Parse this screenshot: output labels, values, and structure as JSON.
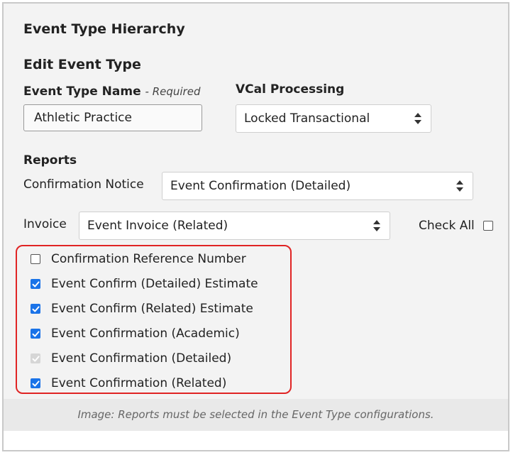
{
  "header": {
    "title": "Event Type Hierarchy",
    "subtitle": "Edit Event Type"
  },
  "form": {
    "name_label": "Event Type Name",
    "required_label": "- Required",
    "name_value": "Athletic Practice",
    "vcal_label": "VCal Processing",
    "vcal_value": "Locked Transactional"
  },
  "reports": {
    "section_label": "Reports",
    "confirmation_label": "Confirmation Notice",
    "confirmation_value": "Event Confirmation (Detailed)",
    "invoice_label": "Invoice",
    "invoice_value": "Event Invoice (Related)",
    "check_all_label": "Check All",
    "items": [
      {
        "label": "Confirmation Reference Number",
        "state": "unchecked"
      },
      {
        "label": "Event Confirm (Detailed) Estimate",
        "state": "checked"
      },
      {
        "label": "Event Confirm (Related) Estimate",
        "state": "checked"
      },
      {
        "label": "Event Confirmation (Academic)",
        "state": "checked"
      },
      {
        "label": "Event Confirmation (Detailed)",
        "state": "checked-disabled"
      },
      {
        "label": "Event Confirmation (Related)",
        "state": "checked"
      }
    ]
  },
  "caption": "Image: Reports must be selected in the Event Type configurations.",
  "colors": {
    "checkbox_accent": "#1a73e8",
    "highlight_border": "#e02424",
    "panel_bg": "#f3f3f3"
  },
  "icons": {
    "select_arrows": "up-down-chevron-icon",
    "checkmark": "checkmark-icon"
  }
}
